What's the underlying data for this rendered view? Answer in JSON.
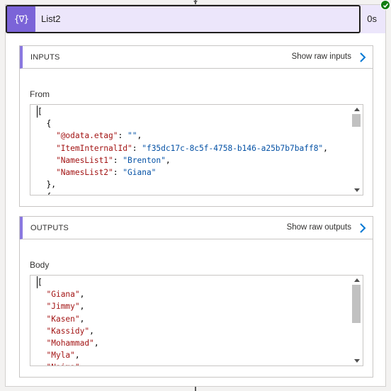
{
  "action": {
    "title": "List2",
    "duration": "0s",
    "icon": "filter-array-icon",
    "icon_text": "{∇}",
    "status": "succeeded",
    "accent_color": "#7b64d8"
  },
  "inputs": {
    "heading": "INPUTS",
    "raw_link": "Show raw inputs",
    "field_label": "From",
    "code": {
      "open": "[",
      "obj_open": "{",
      "props": [
        {
          "key": "\"@odata.etag\"",
          "value": "\"\"",
          "trail": ","
        },
        {
          "key": "\"ItemInternalId\"",
          "value": "\"f35dc17c-8c5f-4758-b146-a25b7b7baff8\"",
          "trail": ","
        },
        {
          "key": "\"NamesList1\"",
          "value": "\"Brenton\"",
          "trail": ","
        },
        {
          "key": "\"NamesList2\"",
          "value": "\"Giana\"",
          "trail": ""
        }
      ],
      "obj_close": "},",
      "next_open": "{"
    }
  },
  "outputs": {
    "heading": "OUTPUTS",
    "raw_link": "Show raw outputs",
    "field_label": "Body",
    "code": {
      "open": "[",
      "items": [
        "\"Giana\",",
        "\"Jimmy\",",
        "\"Kasen\",",
        "\"Kassidy\",",
        "\"Mohammad\",",
        "\"Myla\",",
        "\"Naima\","
      ]
    }
  }
}
